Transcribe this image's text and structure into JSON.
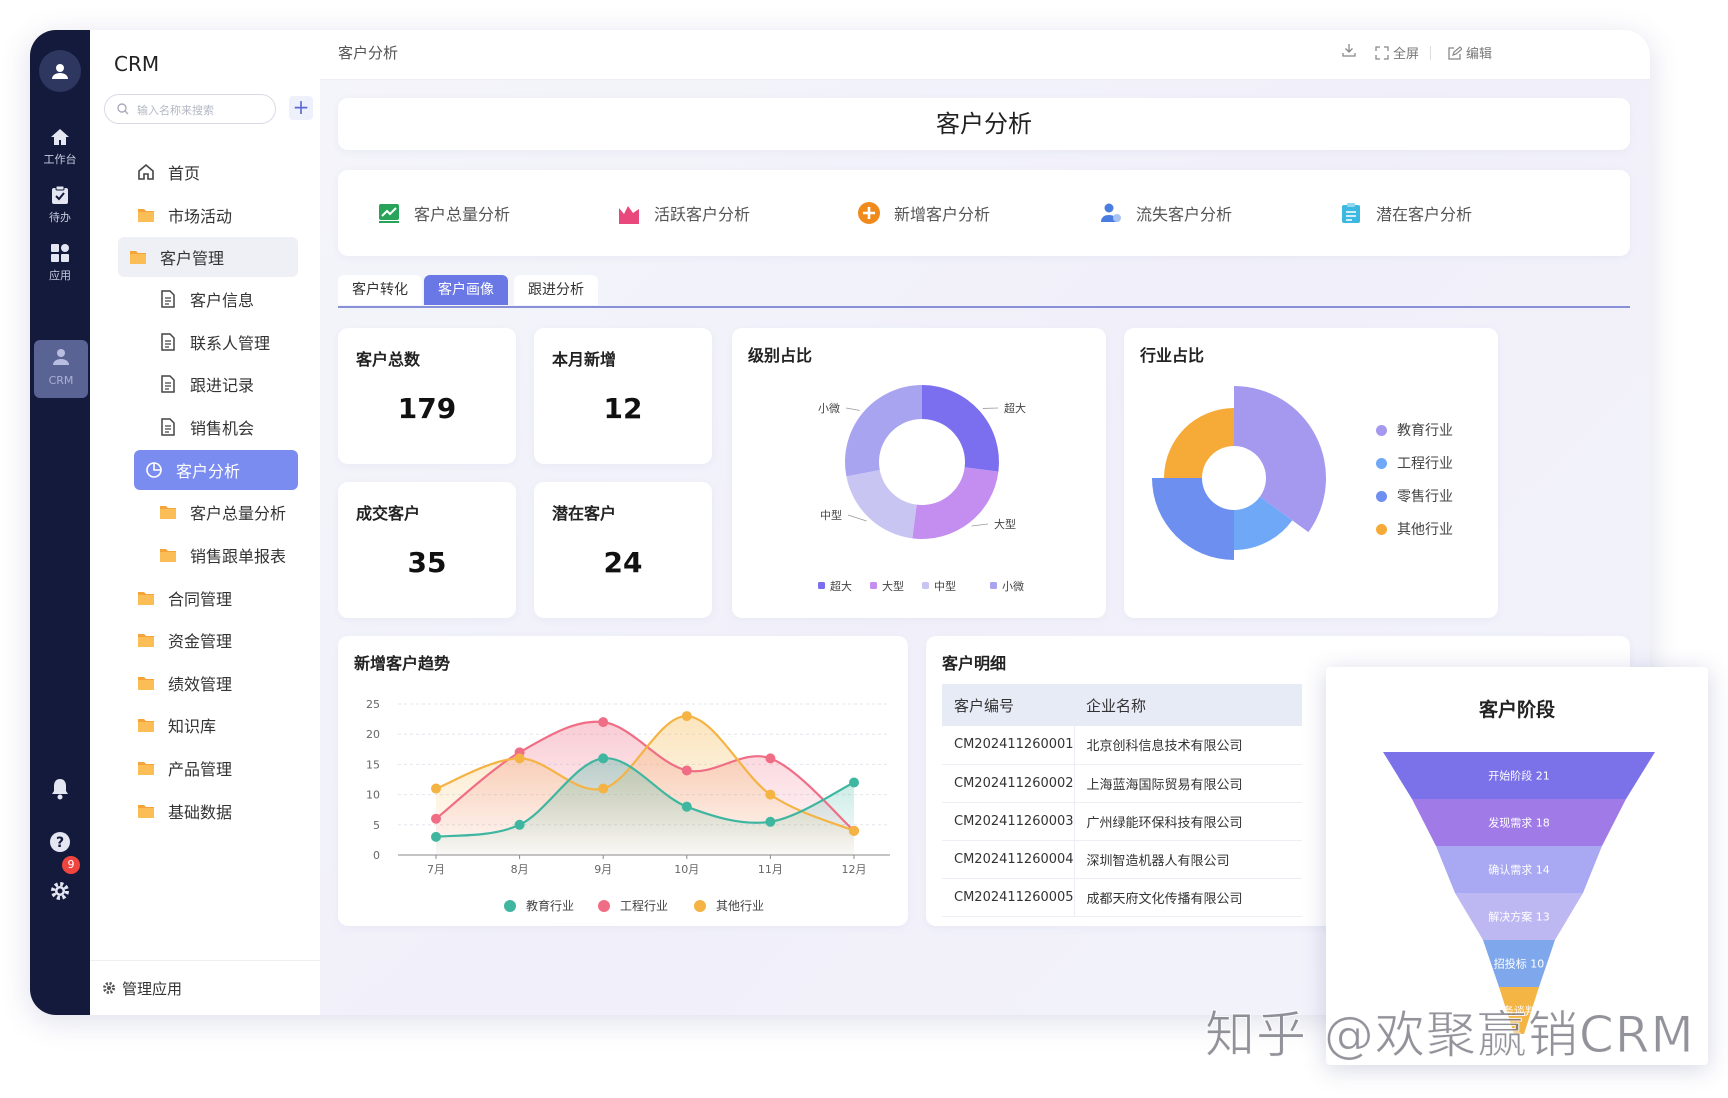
{
  "rail": {
    "items": [
      {
        "label": "工作台",
        "icon": "home-icon"
      },
      {
        "label": "待办",
        "icon": "clipboard-icon"
      },
      {
        "label": "应用",
        "icon": "grid-icon"
      },
      {
        "label": "CRM",
        "icon": "user-icon"
      }
    ],
    "notification_count": "9"
  },
  "sidebar": {
    "title": "CRM",
    "search_placeholder": "输入名称来搜索",
    "add_label": "+",
    "items": [
      {
        "label": "首页"
      },
      {
        "label": "市场活动"
      },
      {
        "label": "客户管理"
      },
      {
        "label": "客户信息"
      },
      {
        "label": "联系人管理"
      },
      {
        "label": "跟进记录"
      },
      {
        "label": "销售机会"
      },
      {
        "label": "客户分析"
      },
      {
        "label": "客户总量分析"
      },
      {
        "label": "销售跟单报表"
      },
      {
        "label": "合同管理"
      },
      {
        "label": "资金管理"
      },
      {
        "label": "绩效管理"
      },
      {
        "label": "知识库"
      },
      {
        "label": "产品管理"
      },
      {
        "label": "基础数据"
      }
    ],
    "footer": "管理应用"
  },
  "topbar": {
    "breadcrumb": "客户分析",
    "fullscreen": "全屏",
    "edit": "编辑"
  },
  "page_title": "客户分析",
  "nav": [
    {
      "label": "客户总量分析",
      "color": "#27a35a"
    },
    {
      "label": "活跃客户分析",
      "color": "#e8487c"
    },
    {
      "label": "新增客户分析",
      "color": "#f08a1c"
    },
    {
      "label": "流失客户分析",
      "color": "#4a7de0"
    },
    {
      "label": "潜在客户分析",
      "color": "#3db8e0"
    }
  ],
  "tabs": [
    {
      "label": "客户转化"
    },
    {
      "label": "客户画像"
    },
    {
      "label": "跟进分析"
    }
  ],
  "stats": [
    {
      "title": "客户总数",
      "value": "179"
    },
    {
      "title": "本月新增",
      "value": "12"
    },
    {
      "title": "成交客户",
      "value": "35"
    },
    {
      "title": "潜在客户",
      "value": "24"
    }
  ],
  "level_chart": {
    "title": "级别占比",
    "labels": [
      "超大",
      "大型",
      "中型",
      "小微"
    ]
  },
  "industry_chart": {
    "title": "行业占比",
    "legend": [
      "教育行业",
      "工程行业",
      "零售行业",
      "其他行业"
    ]
  },
  "trend_chart": {
    "title": "新增客户趋势"
  },
  "detail_table": {
    "title": "客户明细",
    "headers": [
      "客户编号",
      "企业名称"
    ],
    "rows": [
      [
        "CM202411260001",
        "北京创科信息技术有限公司"
      ],
      [
        "CM202411260002",
        "上海蓝海国际贸易有限公司"
      ],
      [
        "CM202411260003",
        "广州绿能环保科技有限公司"
      ],
      [
        "CM202411260004",
        "深圳智造机器人有限公司"
      ],
      [
        "CM202411260005",
        "成都天府文化传播有限公司"
      ]
    ]
  },
  "funnel": {
    "title": "客户阶段",
    "stages": [
      {
        "label": "开始阶段 21",
        "color": "#7b71e8"
      },
      {
        "label": "发现需求 18",
        "color": "#a07ae6"
      },
      {
        "label": "确认需求 14",
        "color": "#a9a8f2"
      },
      {
        "label": "解决方案 13",
        "color": "#bdb8f2"
      },
      {
        "label": "招投标 10",
        "color": "#7fa8ec"
      },
      {
        "label": "商务谈判 8",
        "color": "#f5b545"
      }
    ]
  },
  "chart_data": [
    {
      "type": "pie",
      "title": "级别占比",
      "labels": [
        "超大",
        "大型",
        "中型",
        "小微"
      ],
      "values": [
        27,
        25,
        20,
        28
      ],
      "colors": [
        "#7b6ff0",
        "#c48ef0",
        "#c9c5f2",
        "#a9a4f0"
      ],
      "legend": "bottom"
    },
    {
      "type": "pie",
      "title": "行业占比",
      "labels": [
        "教育行业",
        "工程行业",
        "零售行业",
        "其他行业"
      ],
      "values": [
        35,
        15,
        25,
        25
      ],
      "colors": [
        "#a498ef",
        "#6fa8f7",
        "#6c8ff0",
        "#f6ab39"
      ],
      "legend": "right"
    },
    {
      "type": "area",
      "title": "新增客户趋势",
      "categories": [
        "7月",
        "8月",
        "9月",
        "10月",
        "11月",
        "12月"
      ],
      "ylim": [
        0,
        25
      ],
      "yticks": [
        0,
        5,
        10,
        15,
        20,
        25
      ],
      "series": [
        {
          "name": "教育行业",
          "color": "#3fb6a0",
          "values": [
            3,
            5,
            16,
            8,
            5.5,
            12
          ]
        },
        {
          "name": "工程行业",
          "color": "#ef6e86",
          "values": [
            6,
            17,
            22,
            14,
            16,
            4
          ]
        },
        {
          "name": "其他行业",
          "color": "#f4b343",
          "values": [
            11,
            16,
            11,
            23,
            10,
            4
          ]
        }
      ],
      "legend": "bottom"
    }
  ]
}
